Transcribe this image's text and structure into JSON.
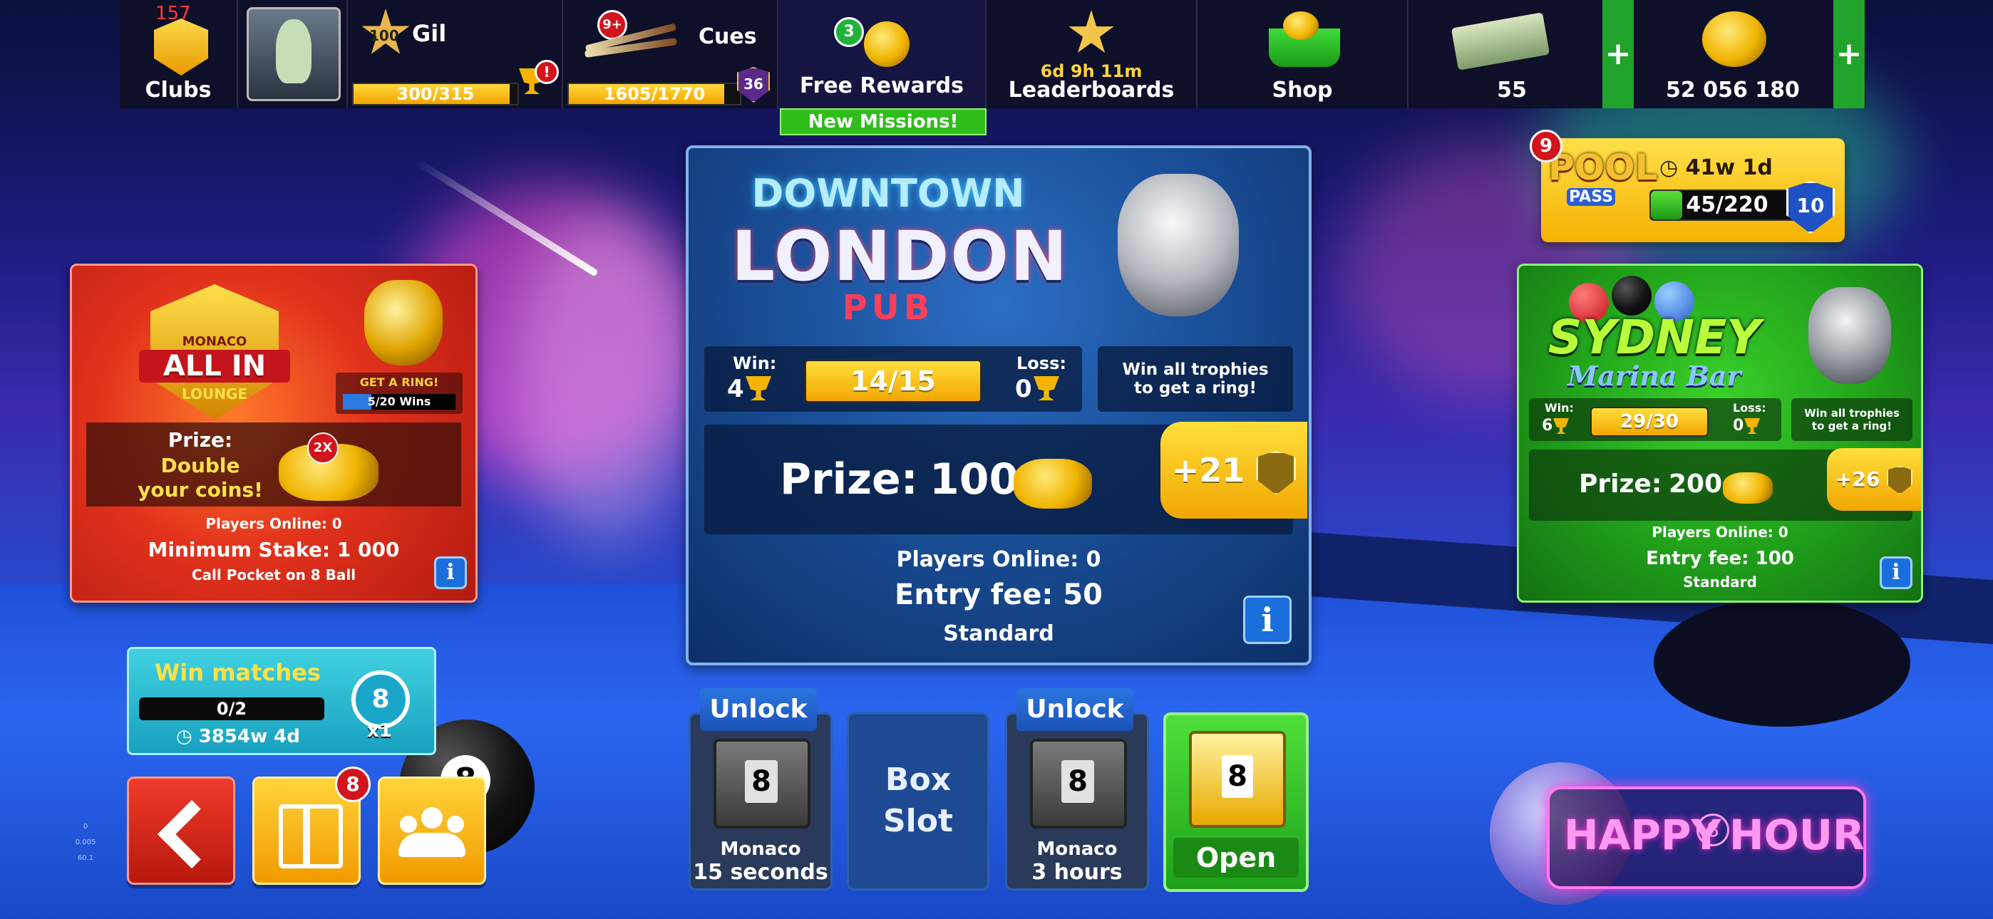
{
  "topbar": {
    "clubs": {
      "count": "157",
      "label": "Clubs"
    },
    "profile": {
      "level": "100",
      "name": "Gil",
      "xp_text": "300/315",
      "xp_fraction": 0.952,
      "alert": "!"
    },
    "cues": {
      "badge": "9+",
      "label": "Cues",
      "progress_text": "1605/1770",
      "progress_fraction": 0.907,
      "level": "36"
    },
    "free_rewards": {
      "badge": "3",
      "label": "Free Rewards",
      "banner": "New Missions!"
    },
    "leaderboards": {
      "timer": "6d 9h 11m",
      "label": "Leaderboards"
    },
    "shop": {
      "label": "Shop"
    },
    "cash": {
      "value": "55",
      "plus": "+"
    },
    "coins": {
      "value": "52 056 180",
      "plus": "+"
    }
  },
  "pool_pass": {
    "badge": "9",
    "logo_top": "POOL",
    "logo_bottom": "PASS",
    "timer": "41w 1d",
    "progress_text": "45/220",
    "progress_fraction": 0.205,
    "level": "10"
  },
  "monaco": {
    "logo_small": "MONACO",
    "logo_main": "ALL IN",
    "logo_sub": "LOUNGE",
    "ring_text": "GET A RING!",
    "ring_progress": "5/20 Wins",
    "ring_fraction": 0.25,
    "prize_label": "Prize:",
    "prize_line1": "Double",
    "prize_line2": "your coins!",
    "multiplier": "2X",
    "players_online": "Players Online: 0",
    "stake": "Minimum Stake: 1 000",
    "rule": "Call Pocket on 8 Ball",
    "info": "i"
  },
  "london": {
    "logo_top": "DOWNTOWN",
    "logo_main": "LONDON",
    "logo_sub": "PUB",
    "win_label": "Win:",
    "win_value": "4",
    "trophy_progress": "14/15",
    "loss_label": "Loss:",
    "loss_value": "0",
    "ring_hint_1": "Win all trophies",
    "ring_hint_2": "to get a ring!",
    "prize_label": "Prize:",
    "prize_value": "100",
    "bonus": "+21",
    "players_online": "Players Online: 0",
    "entry_fee": "Entry fee: 50",
    "mode": "Standard",
    "info": "i"
  },
  "sydney": {
    "logo_main": "SYDNEY",
    "logo_sub": "Marina Bar",
    "win_label": "Win:",
    "win_value": "6",
    "trophy_progress": "29/30",
    "loss_label": "Loss:",
    "loss_value": "0",
    "ring_hint_1": "Win all trophies",
    "ring_hint_2": "to get a ring!",
    "prize_label": "Prize:",
    "prize_value": "200",
    "bonus": "+26",
    "players_online": "Players Online: 0",
    "entry_fee": "Entry fee: 100",
    "mode": "Standard",
    "info": "i"
  },
  "mission": {
    "title": "Win matches",
    "progress_text": "0/2",
    "progress_fraction": 0.0,
    "timer": "3854w 4d",
    "ball": "8",
    "multiplier": "x1"
  },
  "bottom_left": {
    "gift_badge": "8"
  },
  "boxes": [
    {
      "tag": "Unlock",
      "chest_num": "8",
      "name": "Monaco",
      "time": "15 seconds"
    },
    {
      "slot_line1": "Box",
      "slot_line2": "Slot"
    },
    {
      "tag": "Unlock",
      "chest_num": "8",
      "name": "Monaco",
      "time": "3 hours"
    },
    {
      "chest_num": "8",
      "action": "Open"
    }
  ],
  "happy_hour": {
    "left": "HAPPY",
    "mid": "8",
    "right": "HOUR"
  },
  "debug": {
    "v1": "0",
    "v2": "0.005",
    "v3": "60.1"
  },
  "colors": {
    "gold": "#f5a400",
    "green": "#1fa32b",
    "red": "#d2141c",
    "blue": "#1a6fdc"
  }
}
